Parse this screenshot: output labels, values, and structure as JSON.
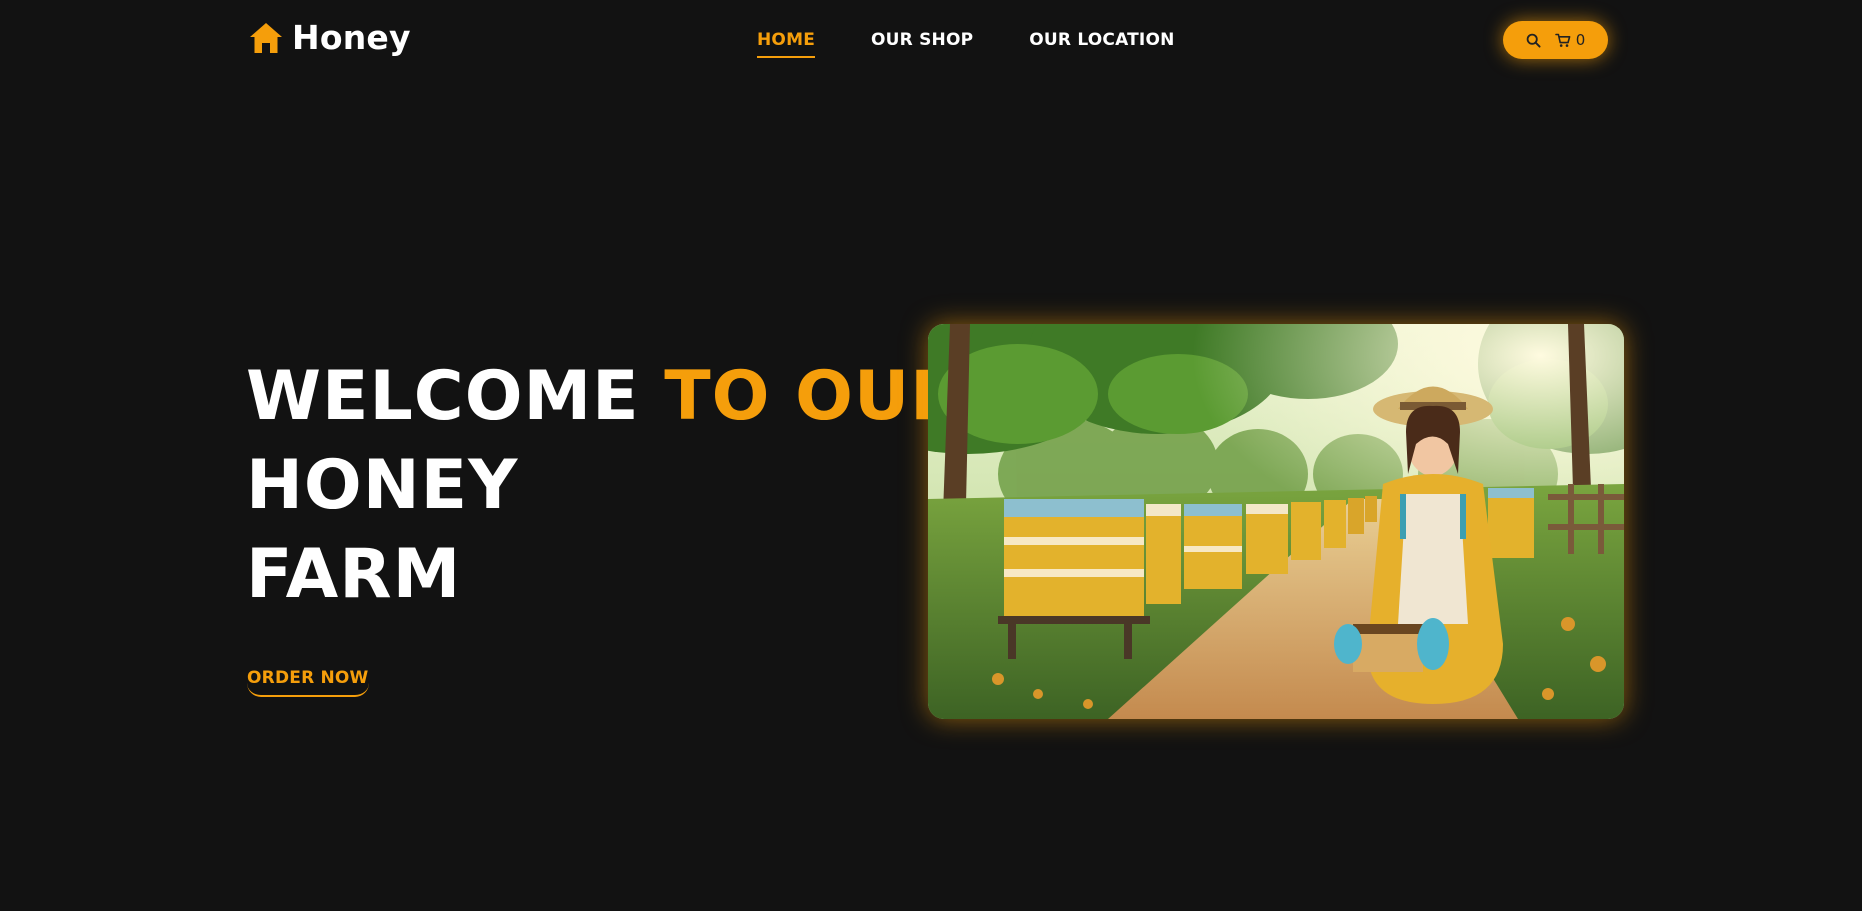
{
  "header": {
    "logo_icon": "house-icon",
    "brand": "Honey",
    "nav": [
      {
        "label": "HOME",
        "active": true
      },
      {
        "label": "OUR SHOP",
        "active": false
      },
      {
        "label": "OUR LOCATION",
        "active": false
      }
    ],
    "actions": {
      "search_icon": "search-icon",
      "cart_icon": "cart-icon",
      "cart_count": "0"
    }
  },
  "hero": {
    "title_line1_white": "WELCOME ",
    "title_line1_accent": "TO OUR",
    "title_line2": "HONEY",
    "title_line3": "FARM",
    "cta": "ORDER NOW",
    "image_subject": "beekeeper woman holding honeycomb frame beside row of beehives"
  },
  "colors": {
    "background": "#121212",
    "accent": "#f59e0b",
    "text": "#ffffff"
  }
}
